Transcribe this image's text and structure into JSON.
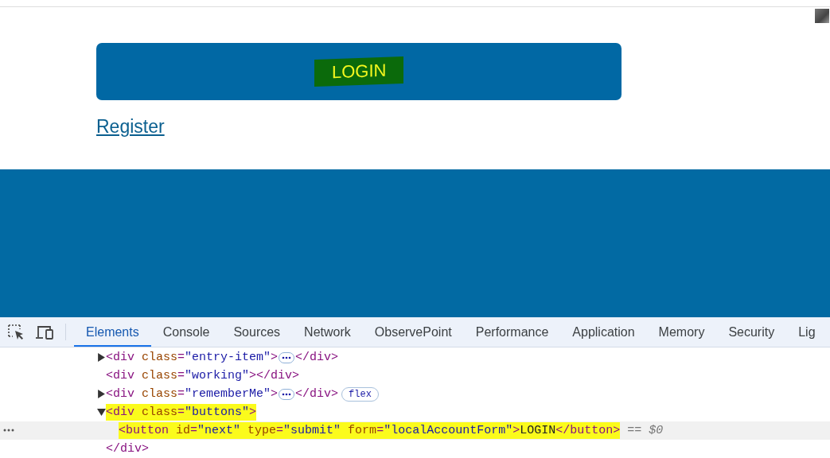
{
  "page": {
    "login_button": {
      "label": "LOGIN",
      "highlighted": true
    },
    "register_link": "Register"
  },
  "devtools": {
    "tabs": [
      {
        "label": "Elements",
        "selected": true
      },
      {
        "label": "Console",
        "selected": false
      },
      {
        "label": "Sources",
        "selected": false
      },
      {
        "label": "Network",
        "selected": false
      },
      {
        "label": "ObservePoint",
        "selected": false
      },
      {
        "label": "Performance",
        "selected": false
      },
      {
        "label": "Application",
        "selected": false
      },
      {
        "label": "Memory",
        "selected": false
      },
      {
        "label": "Security",
        "selected": false
      },
      {
        "label": "Lig",
        "selected": false
      }
    ],
    "nodes": [
      {
        "expanded": false,
        "collapsed": true,
        "selected": false,
        "highlighted": false,
        "open": [
          {
            "kind": "tag",
            "text": "<div"
          },
          {
            "kind": "attr",
            "text": " class"
          },
          {
            "kind": "tag",
            "text": "="
          },
          {
            "kind": "value",
            "text": "\"entry-item\""
          },
          {
            "kind": "tag",
            "text": ">"
          }
        ],
        "close": [
          {
            "kind": "tag",
            "text": "</div>"
          }
        ]
      },
      {
        "selected": false,
        "highlighted": false,
        "open": [
          {
            "kind": "tag",
            "text": "<div"
          },
          {
            "kind": "attr",
            "text": " class"
          },
          {
            "kind": "tag",
            "text": "="
          },
          {
            "kind": "value",
            "text": "\"working\""
          },
          {
            "kind": "tag",
            "text": "></div>"
          }
        ]
      },
      {
        "expanded": false,
        "collapsed": true,
        "selected": false,
        "highlighted": false,
        "open": [
          {
            "kind": "tag",
            "text": "<div"
          },
          {
            "kind": "attr",
            "text": " class"
          },
          {
            "kind": "tag",
            "text": "="
          },
          {
            "kind": "value",
            "text": "\"rememberMe\""
          },
          {
            "kind": "tag",
            "text": ">"
          }
        ],
        "close": [
          {
            "kind": "tag",
            "text": "</div>"
          }
        ],
        "badge": "flex"
      },
      {
        "expanded": true,
        "selected": false,
        "highlighted": true,
        "open": [
          {
            "kind": "tag",
            "text": "<div"
          },
          {
            "kind": "attr",
            "text": " class"
          },
          {
            "kind": "tag",
            "text": "="
          },
          {
            "kind": "value",
            "text": "\"buttons\""
          },
          {
            "kind": "tag",
            "text": ">"
          }
        ],
        "children": [
          {
            "selected": true,
            "highlighted": true,
            "open": [
              {
                "kind": "tag",
                "text": "<button"
              },
              {
                "kind": "attr",
                "text": " id"
              },
              {
                "kind": "tag",
                "text": "="
              },
              {
                "kind": "value",
                "text": "\"next\""
              },
              {
                "kind": "attr",
                "text": " type"
              },
              {
                "kind": "tag",
                "text": "="
              },
              {
                "kind": "value",
                "text": "\"submit\""
              },
              {
                "kind": "attr",
                "text": " form"
              },
              {
                "kind": "tag",
                "text": "="
              },
              {
                "kind": "value",
                "text": "\"localAccountForm\""
              },
              {
                "kind": "tag",
                "text": ">"
              },
              {
                "kind": "text",
                "text": "LOGIN"
              },
              {
                "kind": "tag",
                "text": "</button>"
              }
            ],
            "note": "== $0"
          }
        ],
        "end": [
          {
            "kind": "tag",
            "text": "</div>"
          }
        ]
      }
    ]
  }
}
